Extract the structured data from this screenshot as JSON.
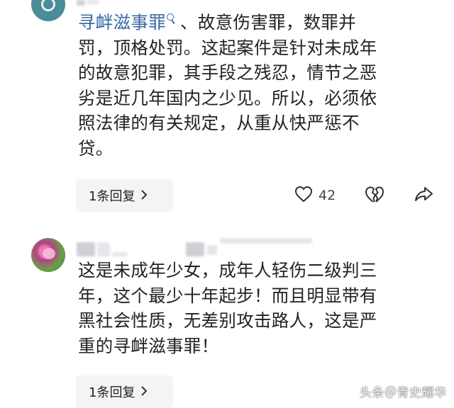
{
  "comments": [
    {
      "link_text": "寻衅滋事罪",
      "text_lines": [
        "、故意伤害罪，数罪并",
        "罚，顶格处罚。这起案件是针对未成年",
        "的故意犯罪，其手段之残忍，情节之恶",
        "劣是近几年国内之少见。所以，必须依",
        "照法律的有关规定，从重从快严惩不",
        "贷。"
      ],
      "reply_label": "1条回复",
      "like_count": "42"
    },
    {
      "text_lines": [
        "这是未成年少女，成年人轻伤二级判三",
        "年，这个最少十年起步！而且明显带有",
        "黑社会性质，无差别攻击路人，这是严",
        "重的寻衅滋事罪！"
      ],
      "reply_label": "1条回复"
    }
  ],
  "icons": {
    "search": "search-icon",
    "reply_chevron": "chevron-right-icon",
    "like": "heart-icon",
    "dislike": "broken-heart-icon",
    "share": "share-icon"
  },
  "watermark": "头条＠青史耀华",
  "colors": {
    "link": "#3b69a6",
    "text": "#222222",
    "reply_bg": "#f4f4f6"
  }
}
